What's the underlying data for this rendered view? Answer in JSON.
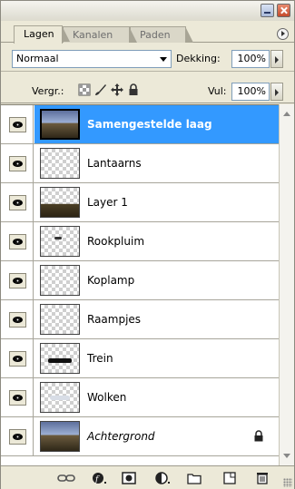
{
  "tabs": [
    {
      "label": "Lagen",
      "active": true
    },
    {
      "label": "Kanalen",
      "active": false
    },
    {
      "label": "Paden",
      "active": false
    }
  ],
  "blend_mode": {
    "value": "Normaal"
  },
  "opacity": {
    "label": "Dekking:",
    "value": "100%"
  },
  "lock": {
    "label": "Vergr.:",
    "icons": [
      "lock-transparent-icon",
      "lock-brush-icon",
      "lock-move-icon",
      "lock-all-icon"
    ]
  },
  "fill": {
    "label": "Vul:",
    "value": "100%"
  },
  "layers": [
    {
      "name": "Samengestelde laag",
      "selected": true,
      "italic": false,
      "thumb": "photo"
    },
    {
      "name": "Lantaarns",
      "selected": false,
      "italic": false,
      "thumb": "empty"
    },
    {
      "name": "Layer 1",
      "selected": false,
      "italic": false,
      "thumb": "landscape"
    },
    {
      "name": "Rookpluim",
      "selected": false,
      "italic": false,
      "thumb": "smoke"
    },
    {
      "name": "Koplamp",
      "selected": false,
      "italic": false,
      "thumb": "empty"
    },
    {
      "name": "Raampjes",
      "selected": false,
      "italic": false,
      "thumb": "empty"
    },
    {
      "name": "Trein",
      "selected": false,
      "italic": false,
      "thumb": "train"
    },
    {
      "name": "Wolken",
      "selected": false,
      "italic": false,
      "thumb": "clouds"
    },
    {
      "name": "Achtergrond",
      "selected": false,
      "italic": true,
      "thumb": "photo",
      "locked": true
    }
  ],
  "bottom_icons": [
    "link-layers-icon",
    "layer-style-icon",
    "layer-mask-icon",
    "adjustment-layer-icon",
    "new-group-icon",
    "new-layer-icon",
    "delete-layer-icon"
  ],
  "colors": {
    "selection": "#3399ff",
    "panel": "#ece9d8"
  }
}
